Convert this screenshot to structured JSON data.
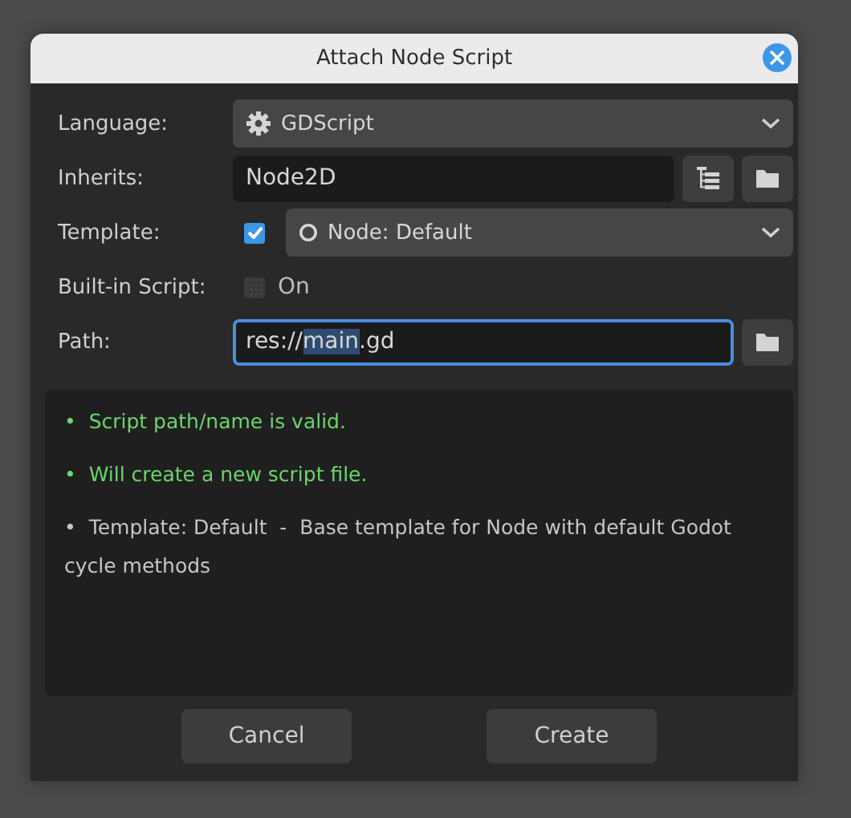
{
  "window": {
    "title": "Attach Node Script"
  },
  "form": {
    "language": {
      "label": "Language:",
      "value": "GDScript"
    },
    "inherits": {
      "label": "Inherits:",
      "value": "Node2D"
    },
    "template": {
      "label": "Template:",
      "checked": true,
      "value": "Node: Default"
    },
    "builtin": {
      "label": "Built-in Script:",
      "checked": false,
      "disabled": true,
      "text": "On"
    },
    "path": {
      "label": "Path:",
      "focused": true,
      "parts": [
        {
          "text": "res://",
          "selected": false
        },
        {
          "text": "main",
          "selected": true
        },
        {
          "text": ".gd",
          "selected": false
        }
      ]
    }
  },
  "messages": [
    {
      "kind": "success",
      "text": "•  Script path/name is valid."
    },
    {
      "kind": "success",
      "text": "•  Will create a new script file."
    },
    {
      "kind": "info",
      "text": "•  Template: Default  -  Base template for Node with default Godot cycle methods"
    }
  ],
  "buttons": [
    {
      "label": "Cancel"
    },
    {
      "label": "Create"
    }
  ]
}
